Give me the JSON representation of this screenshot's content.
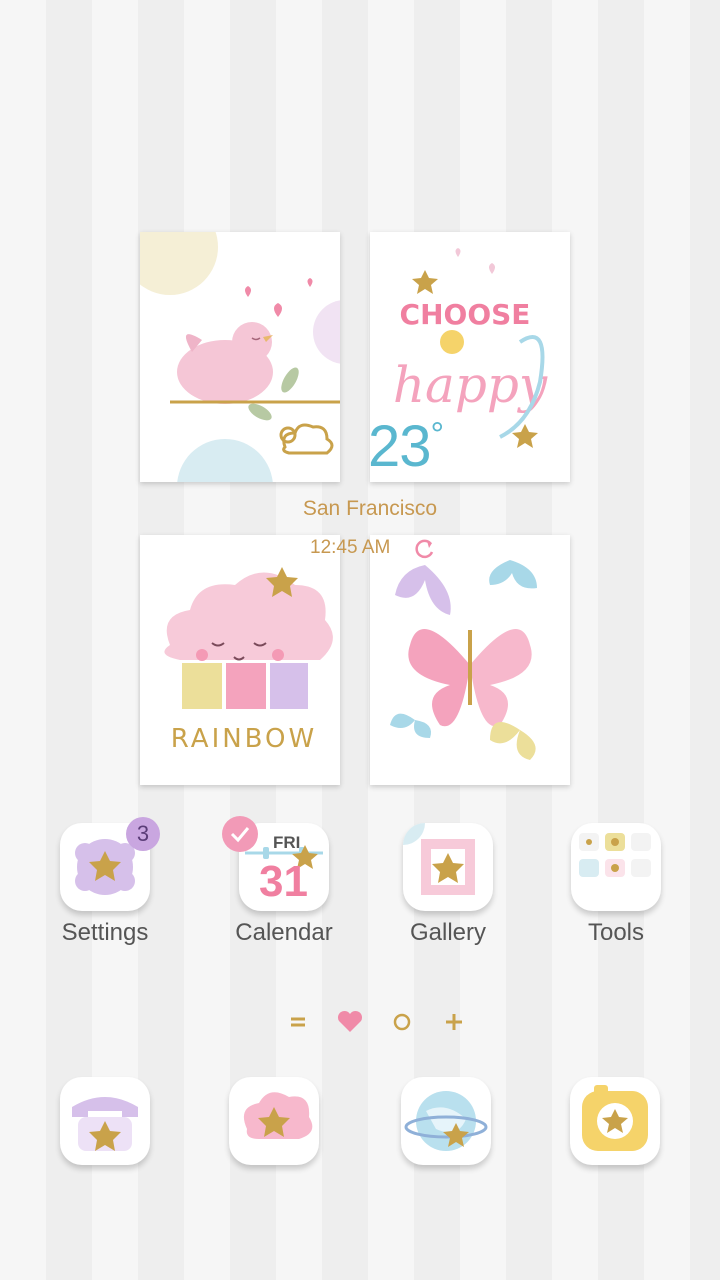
{
  "weather": {
    "temperature": "23",
    "degree_symbol": "°",
    "city": "San Francisco",
    "time": "12:45 AM"
  },
  "cards": {
    "choose_word": "CHOOSE",
    "happy_word": "happy",
    "rainbow_word": "RAINBOW"
  },
  "apps": [
    {
      "label": "Settings",
      "badge": "3"
    },
    {
      "label": "Calendar",
      "day_abbr": "FRI",
      "date": "31"
    },
    {
      "label": "Gallery"
    },
    {
      "label": "Tools"
    }
  ],
  "dock": [
    {
      "icon": "phone-icon"
    },
    {
      "icon": "messages-icon"
    },
    {
      "icon": "browser-icon"
    },
    {
      "icon": "camera-icon"
    }
  ],
  "page_indicators": [
    "menu-indicator",
    "heart-indicator",
    "circle-indicator",
    "add-page-indicator"
  ],
  "colors": {
    "gold": "#c9a24a",
    "pink": "#f4a3bd",
    "lilac": "#d6c0ea",
    "sky": "#a8d8e8",
    "temp_blue": "#5ab7cf",
    "label_gold": "#c79850"
  }
}
